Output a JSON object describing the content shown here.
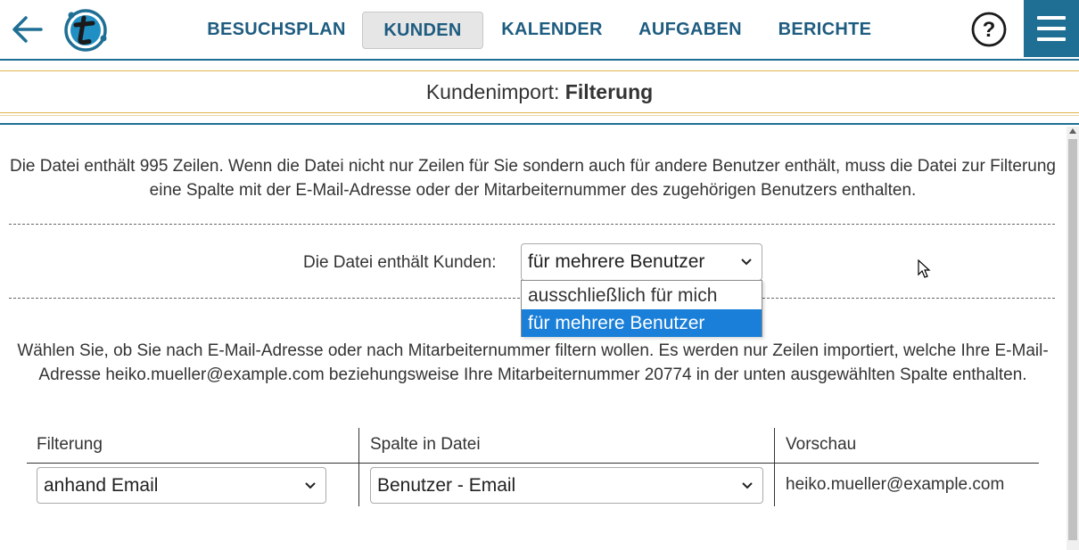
{
  "nav": {
    "items": [
      {
        "label": "BESUCHSPLAN"
      },
      {
        "label": "KUNDEN"
      },
      {
        "label": "KALENDER"
      },
      {
        "label": "AUFGABEN"
      },
      {
        "label": "BERICHTE"
      }
    ],
    "active": "KUNDEN",
    "help_label": "?",
    "icons": {
      "back": "arrow-left-icon",
      "logo": "t-logo",
      "help": "question-circle-icon",
      "menu": "hamburger-menu-icon"
    }
  },
  "page": {
    "title_prefix": "Kundenimport: ",
    "title_bold": "Filterung"
  },
  "intro_text": "Die Datei enthält 995 Zeilen. Wenn die Datei nicht nur Zeilen für Sie sondern auch für andere Benutzer enthält, muss die Datei zur Filterung eine Spalte mit der E-Mail-Adresse oder der Mitarbeiternummer des zugehörigen Benutzers enthalten.",
  "customers_for": {
    "label": "Die Datei enthält Kunden:",
    "selected": "für mehrere Benutzer",
    "options": [
      "ausschließlich für mich",
      "für mehrere Benutzer"
    ]
  },
  "filter_text": "Wählen Sie, ob Sie nach E-Mail-Adresse oder nach Mitarbeiternummer filtern wollen. Es werden nur Zeilen importiert, welche Ihre E-Mail-Adresse heiko.mueller@example.com beziehungsweise Ihre Mitarbeiternummer 20774 in der unten ausgewählten Spalte enthalten.",
  "table": {
    "headers": [
      "Filterung",
      "Spalte in Datei",
      "Vorschau"
    ],
    "filter_select": "anhand Email",
    "column_select": "Benutzer - Email",
    "preview": "heiko.mueller@example.com"
  },
  "colors": {
    "primary": "#1f6f94",
    "nav_text": "#1e5c80",
    "accent_line": "#e0b34a",
    "option_highlight": "#1a7fd8"
  }
}
